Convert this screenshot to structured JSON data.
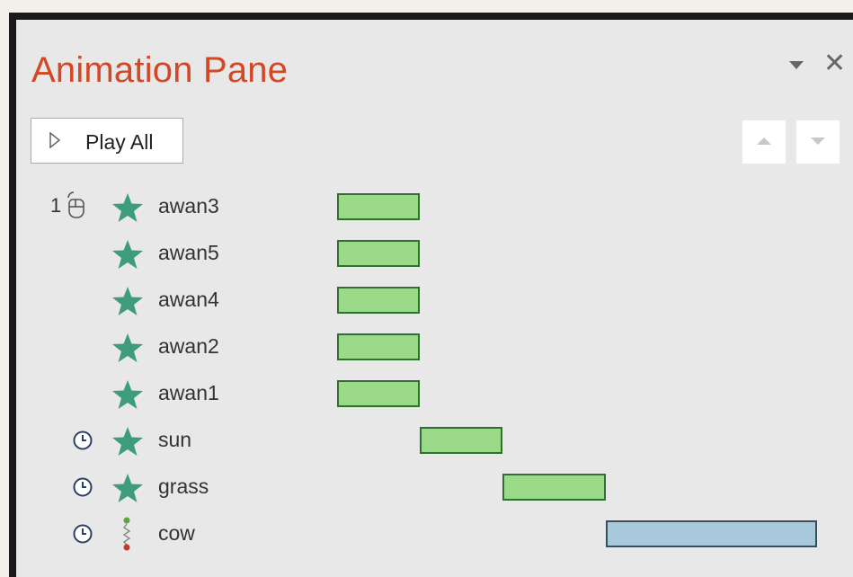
{
  "pane": {
    "title": "Animation Pane",
    "play_all_label": "Play All"
  },
  "icons": {
    "dropdown": "chevron-down-icon",
    "close": "close-icon",
    "play": "play-icon",
    "move_up": "move-up-icon",
    "move_down": "move-down-icon",
    "on_click": "mouse-click-icon",
    "after_previous": "clock-icon",
    "emphasis": "star-icon",
    "motion_path": "motion-path-icon"
  },
  "colors": {
    "title": "#d24726",
    "emphasis_star": "#3e9c7d",
    "emphasis_bar": "#9ad987",
    "path_bar": "#a8c9dc"
  },
  "animations": [
    {
      "order": "1",
      "trigger": "on-click",
      "effect": "emphasis",
      "name": "awan3",
      "timeline_start": 0,
      "timeline_end": 1
    },
    {
      "order": "",
      "trigger": "with-previous",
      "effect": "emphasis",
      "name": "awan5",
      "timeline_start": 0,
      "timeline_end": 1
    },
    {
      "order": "",
      "trigger": "with-previous",
      "effect": "emphasis",
      "name": "awan4",
      "timeline_start": 0,
      "timeline_end": 1
    },
    {
      "order": "",
      "trigger": "with-previous",
      "effect": "emphasis",
      "name": "awan2",
      "timeline_start": 0,
      "timeline_end": 1
    },
    {
      "order": "",
      "trigger": "with-previous",
      "effect": "emphasis",
      "name": "awan1",
      "timeline_start": 0,
      "timeline_end": 1
    },
    {
      "order": "",
      "trigger": "after-previous",
      "effect": "emphasis",
      "name": "sun",
      "timeline_start": 1,
      "timeline_end": 2
    },
    {
      "order": "",
      "trigger": "after-previous",
      "effect": "emphasis",
      "name": "grass",
      "timeline_start": 2,
      "timeline_end": 3.25
    },
    {
      "order": "",
      "trigger": "after-previous",
      "effect": "motion-path",
      "name": "cow",
      "timeline_start": 3.25,
      "timeline_end": 5.8
    }
  ]
}
